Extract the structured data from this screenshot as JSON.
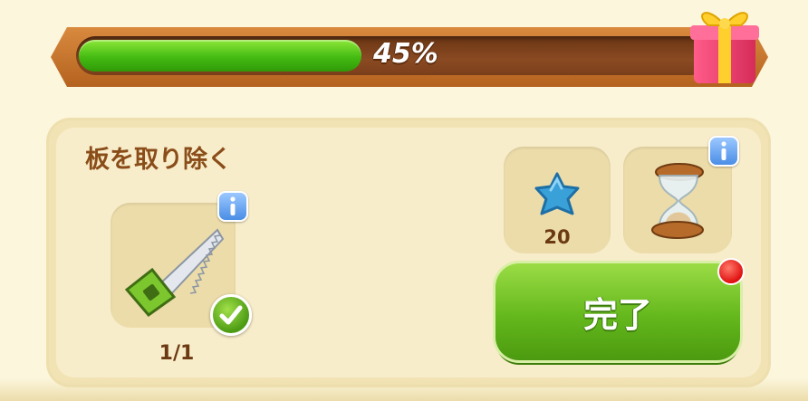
{
  "progress": {
    "value": 0.45,
    "label": "45%"
  },
  "reward_icon": "gift-box-icon",
  "task": {
    "title": "板を取り除く",
    "required_item": {
      "icon": "saw-icon",
      "count_text": "1/1",
      "completed": true
    },
    "rewards": [
      {
        "icon": "blue-star-shell-icon",
        "amount": "20"
      },
      {
        "icon": "hourglass-icon",
        "amount": ""
      }
    ],
    "complete_button_label": "完了",
    "has_notification": true
  },
  "colors": {
    "progress_fill": "#44bb12",
    "progress_frame": "#b4621f",
    "title_text": "#8a4d19",
    "button_green": "#64b81c",
    "info_blue": "#4a8ee6",
    "notification_red": "#e01010"
  }
}
